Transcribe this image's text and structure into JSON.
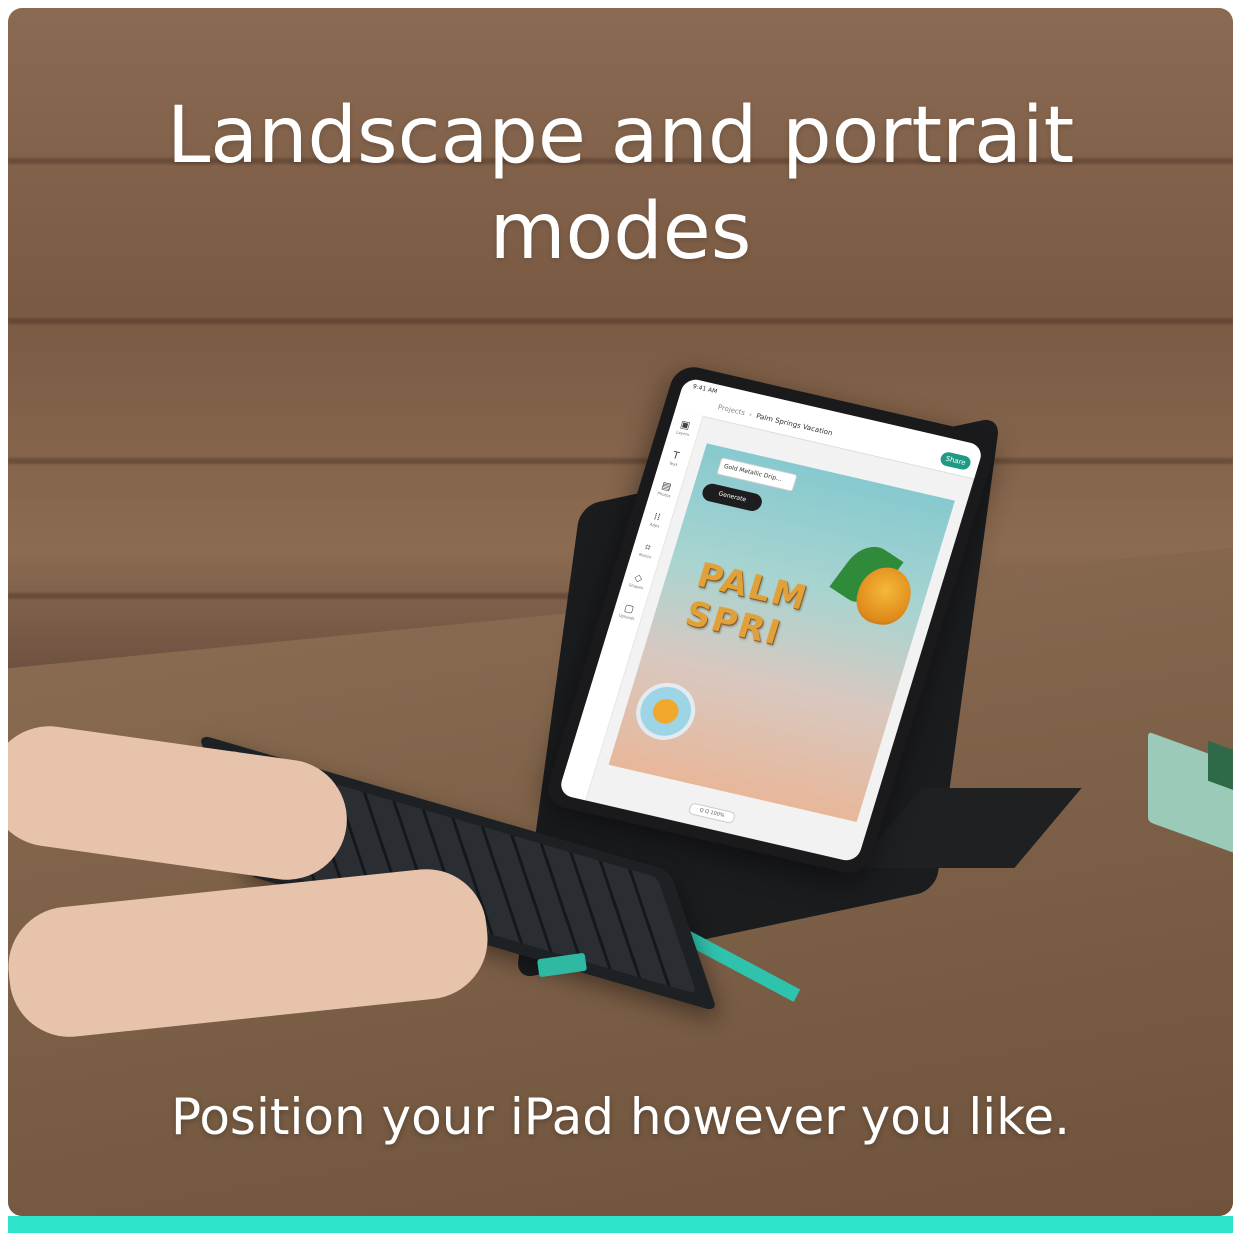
{
  "headline": {
    "line1": "Landscape and portrait",
    "line2": "modes"
  },
  "subline": "Position your iPad however you like.",
  "tablet_app": {
    "breadcrumb_parent": "Projects",
    "breadcrumb_current": "Palm Springs Vacation",
    "share_label": "Share",
    "prompt_text": "Gold Metallic Drip...",
    "generate_label": "Generate",
    "artwork_text_line1": "PALM",
    "artwork_text_line2": "SPRI",
    "zoom_label": "Q Q 100%",
    "sidebar_items": [
      {
        "icon": "layers-icon",
        "label": "Layers"
      },
      {
        "icon": "text-icon",
        "label": "Text"
      },
      {
        "icon": "photos-icon",
        "label": "Photos"
      },
      {
        "icon": "apps-icon",
        "label": "Apps"
      },
      {
        "icon": "resize-icon",
        "label": "Resize"
      },
      {
        "icon": "shapes-icon",
        "label": "Shapes"
      },
      {
        "icon": "uploads-icon",
        "label": "Uploads"
      }
    ]
  },
  "colors": {
    "accent": "#2ee5cc",
    "share_button": "#1e9a85",
    "keyboard": "#1e2124"
  }
}
